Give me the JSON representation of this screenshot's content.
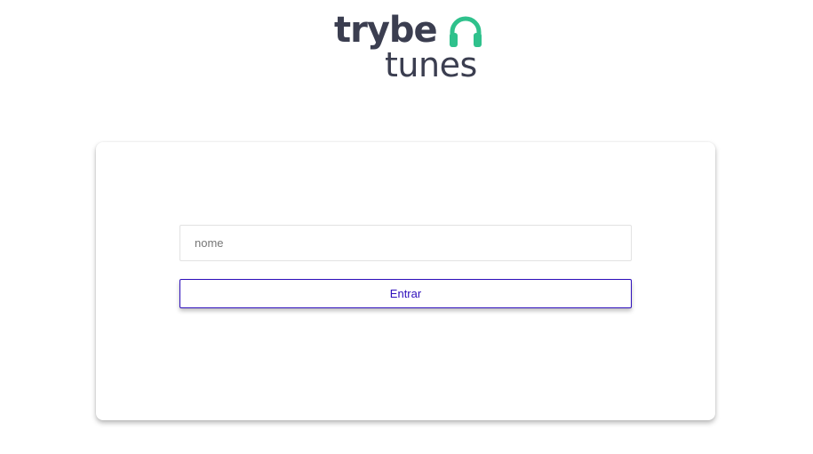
{
  "logo": {
    "word1": "trybe",
    "word2": "tunes",
    "icon": "headphones-icon",
    "text_color": "#3b3e50",
    "accent_color": "#2fc18c"
  },
  "login": {
    "name_placeholder": "nome",
    "name_value": "",
    "submit_label": "Entrar",
    "button_color": "#2e0fbb"
  }
}
